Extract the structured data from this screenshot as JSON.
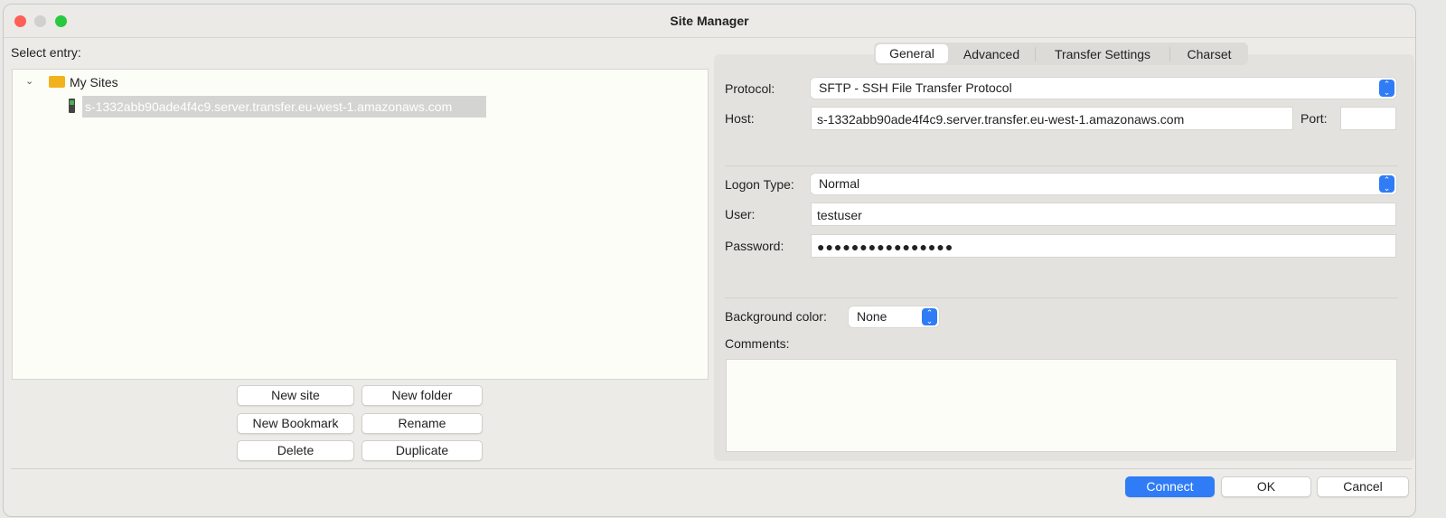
{
  "window": {
    "title": "Site Manager"
  },
  "left": {
    "select_label": "Select entry:",
    "tree": {
      "folder": "My Sites",
      "site": "s-1332abb90ade4f4c9.server.transfer.eu-west-1.amazonaws.com"
    },
    "buttons": {
      "new_site": "New site",
      "new_folder": "New folder",
      "new_bookmark": "New Bookmark",
      "rename": "Rename",
      "delete": "Delete",
      "duplicate": "Duplicate"
    }
  },
  "tabs": [
    "General",
    "Advanced",
    "Transfer Settings",
    "Charset"
  ],
  "general": {
    "protocol_label": "Protocol:",
    "protocol": "SFTP - SSH File Transfer Protocol",
    "host_label": "Host:",
    "host": "s-1332abb90ade4f4c9.server.transfer.eu-west-1.amazonaws.com",
    "port_label": "Port:",
    "port": "",
    "logon_label": "Logon Type:",
    "logon": "Normal",
    "user_label": "User:",
    "user": "testuser",
    "password_label": "Password:",
    "password": "●●●●●●●●●●●●●●●●",
    "bg_label": "Background color:",
    "bg": "None",
    "comments_label": "Comments:",
    "comments": ""
  },
  "footer": {
    "connect": "Connect",
    "ok": "OK",
    "cancel": "Cancel"
  }
}
